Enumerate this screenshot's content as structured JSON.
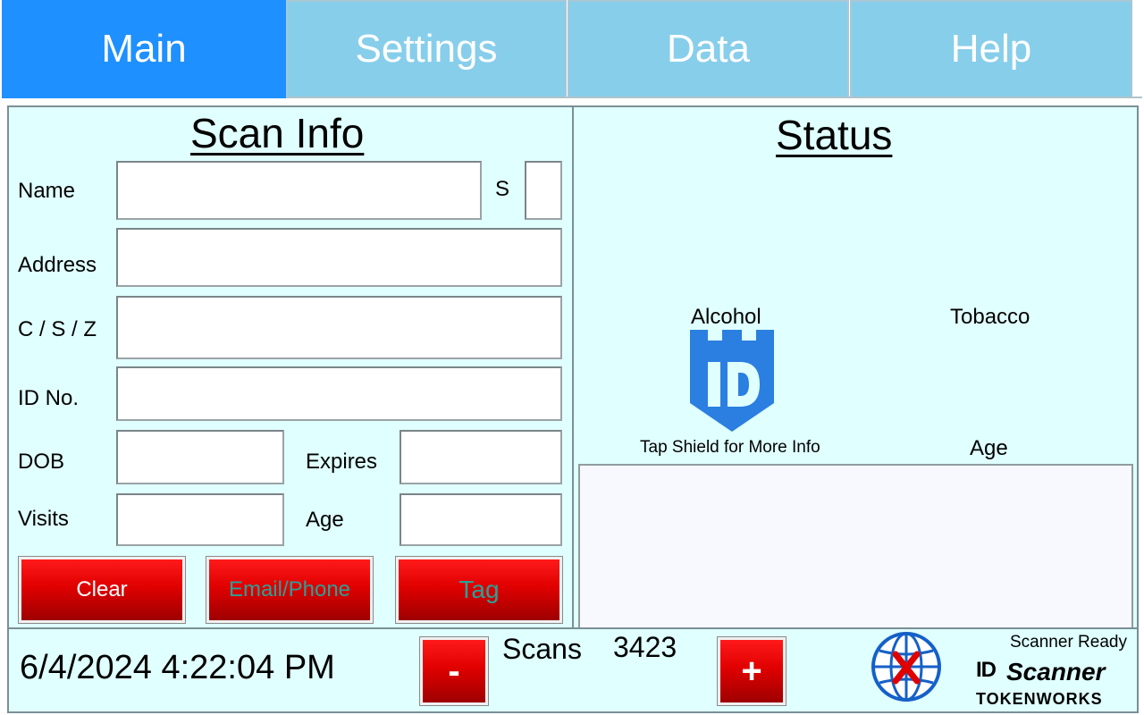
{
  "tabs": [
    {
      "label": "Main",
      "active": true
    },
    {
      "label": "Settings",
      "active": false
    },
    {
      "label": "Data",
      "active": false
    },
    {
      "label": "Help",
      "active": false
    }
  ],
  "scan_info": {
    "title": "Scan Info",
    "fields": {
      "name": {
        "label": "Name",
        "value": ""
      },
      "s": {
        "label": "S",
        "value": ""
      },
      "address": {
        "label": "Address",
        "value": ""
      },
      "csz": {
        "label": "C / S / Z",
        "value": ""
      },
      "id_no": {
        "label": "ID No.",
        "value": ""
      },
      "dob": {
        "label": "DOB",
        "value": ""
      },
      "expires": {
        "label": "Expires",
        "value": ""
      },
      "visits": {
        "label": "Visits",
        "value": ""
      },
      "age": {
        "label": "Age",
        "value": ""
      }
    },
    "buttons": {
      "clear": "Clear",
      "email_phone": "Email/Phone",
      "tag": "Tag"
    }
  },
  "status": {
    "title": "Status",
    "alcohol_label": "Alcohol",
    "tobacco_label": "Tobacco",
    "shield_hint": "Tap Shield for More Info",
    "age_label": "Age",
    "shield_icon": "id-shield-icon"
  },
  "bottom": {
    "datetime": "6/4/2024 4:22:04 PM",
    "scans_label": "Scans",
    "scans_count": "3423",
    "minus_label": "-",
    "plus_label": "+",
    "scanner_status": "Scanner Ready",
    "logo_id": "ID",
    "logo_scanner": "Scanner",
    "logo_company": "TOKENWORKS"
  },
  "colors": {
    "tab_active": "#1e90ff",
    "tab_inactive": "#87ceeb",
    "panel_bg": "#e0ffff",
    "button_red": "#e00000",
    "disabled_text": "#2aa198",
    "shield_blue": "#2b7fe0"
  }
}
